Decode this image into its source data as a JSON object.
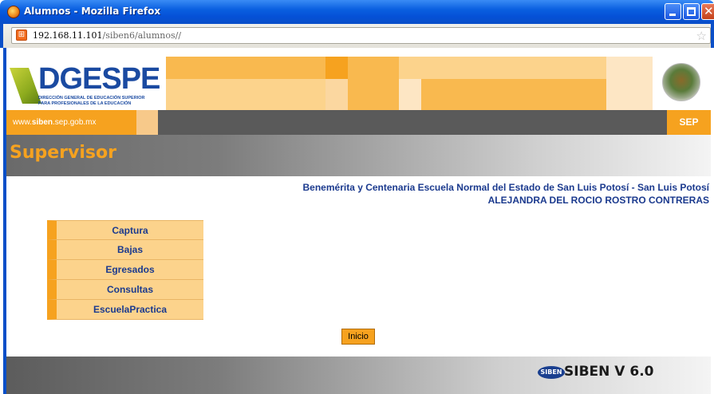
{
  "window": {
    "title": "Alumnos - Mozilla Firefox"
  },
  "address": {
    "url_host": "192.168.11.101",
    "url_rest": "/siben6/alumnos//"
  },
  "banner": {
    "logo_text": "DGESPE",
    "logo_sub_line1": "DIRECCIÓN GENERAL DE EDUCACIÓN SUPERIOR",
    "logo_sub_line2": "PARA PROFESIONALES DE LA EDUCACIÓN",
    "site_prefix": "www.",
    "site_bold": "siben",
    "site_suffix": ".sep.gob.mx",
    "sep_label": "SEP"
  },
  "page": {
    "section_title": "Supervisor",
    "school_name": "Benemérita y Centenaria Escuela Normal del Estado de San Luis Potosí - San Luis Potosí",
    "user_name": "ALEJANDRA DEL ROCIO ROSTRO CONTRERAS"
  },
  "menu": {
    "items": [
      {
        "label": "Captura"
      },
      {
        "label": "Bajas"
      },
      {
        "label": "Egresados"
      },
      {
        "label": "Consultas"
      },
      {
        "label": "EscuelaPractica"
      }
    ]
  },
  "buttons": {
    "inicio": "Inicio"
  },
  "footer": {
    "logo_glyph": "SIBEN",
    "version_text": "SIBEN V 6.0"
  },
  "colors": {
    "orange": "#f6a21f",
    "pale_orange": "#fcd38c",
    "navy": "#1b3a8e",
    "xp_blue": "#0a5fe0"
  }
}
